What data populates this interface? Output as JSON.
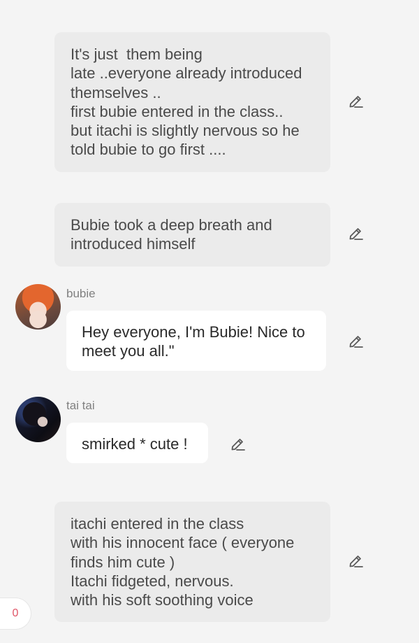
{
  "messages": [
    {
      "type": "narration",
      "lines": [
        "It's just  them being",
        "late ..everyone already introduced",
        "themselves ..",
        "first bubie entered in the class..",
        "but itachi is slightly nervous so he",
        "told bubie to go first ...."
      ],
      "action_icon": "edit-icon"
    },
    {
      "type": "narration",
      "lines": [
        "Bubie took a deep breath and",
        "introduced himself"
      ],
      "action_icon": "edit-icon"
    },
    {
      "type": "character",
      "name": "bubie",
      "lines": [
        "Hey everyone, I'm Bubie! Nice to",
        "meet you all.\""
      ],
      "action_icon": "edit-icon"
    },
    {
      "type": "character",
      "name": "tai tai",
      "lines": [
        "smirked * cute !"
      ],
      "action_icon": "edit-icon"
    },
    {
      "type": "narration",
      "lines": [
        "itachi entered in the class",
        "with his innocent face ( everyone",
        "finds him cute )",
        "Itachi fidgeted, nervous.",
        "with his soft soothing voice"
      ],
      "action_icon": "edit-icon"
    }
  ],
  "counter": {
    "value": "0",
    "color": "#e05567"
  },
  "colors": {
    "background": "#f4f4f4",
    "narration_bubble": "#ebebeb",
    "speech_bubble": "#ffffff",
    "name_text": "#808080"
  }
}
